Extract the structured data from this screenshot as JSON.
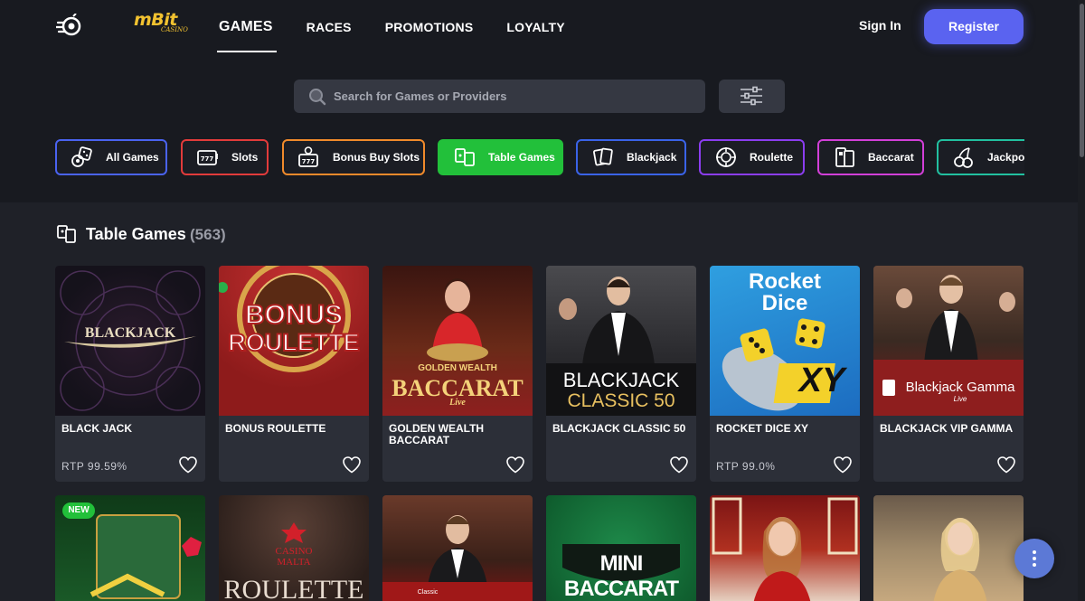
{
  "header": {
    "brand_main": "mBit",
    "brand_sub": "CASINO",
    "nav": [
      {
        "label": "GAMES",
        "active": true
      },
      {
        "label": "RACES",
        "active": false
      },
      {
        "label": "PROMOTIONS",
        "active": false
      },
      {
        "label": "LOYALTY",
        "active": false
      }
    ],
    "signin_label": "Sign In",
    "register_label": "Register"
  },
  "search": {
    "placeholder": "Search for Games or Providers",
    "icon": "search-icon",
    "filter_icon": "sliders-icon"
  },
  "categories": [
    {
      "label": "All Games",
      "icon": "dice-chips-icon",
      "color": "#4a63f0"
    },
    {
      "label": "Slots",
      "icon": "slot-777-icon",
      "color": "#e23b3b"
    },
    {
      "label": "Bonus Buy Slots",
      "icon": "bonus-slot-icon",
      "color": "#f08a2b"
    },
    {
      "label": "Table Games",
      "icon": "table-games-icon",
      "color": "#22c03a",
      "active": true
    },
    {
      "label": "Blackjack",
      "icon": "cards-icon",
      "color": "#3a63e8"
    },
    {
      "label": "Roulette",
      "icon": "roulette-icon",
      "color": "#8b3df0"
    },
    {
      "label": "Baccarat",
      "icon": "baccarat-icon",
      "color": "#d23fd8"
    },
    {
      "label": "Jackpot",
      "icon": "cherries-icon",
      "color": "#22c0a0"
    }
  ],
  "section": {
    "title": "Table Games",
    "count": "(563)"
  },
  "games": [
    {
      "name": "BLACK JACK",
      "rtp": "RTP 99.59%",
      "art_text": "BLACKJACK"
    },
    {
      "name": "BONUS ROULETTE",
      "rtp": "",
      "art_text_1": "BONUS",
      "art_text_2": "ROULETTE"
    },
    {
      "name": "GOLDEN WEALTH BACCARAT",
      "rtp": "",
      "art_text_1": "GOLDEN WEALTH",
      "art_text_2": "BACCARAT",
      "art_text_3": "Live"
    },
    {
      "name": "BLACKJACK CLASSIC 50",
      "rtp": "",
      "art_text_1": "BLACKJACK",
      "art_text_2": "CLASSIC 50"
    },
    {
      "name": "ROCKET DICE XY",
      "rtp": "RTP 99.0%",
      "art_text_1": "Rocket",
      "art_text_2": "Dice",
      "art_text_3": "XY"
    },
    {
      "name": "BLACKJACK VIP GAMMA",
      "rtp": "",
      "art_text_1": "Blackjack Gamma",
      "art_text_2": "Live"
    }
  ],
  "row2": [
    {
      "badge": "NEW"
    },
    {
      "art_text_1": "CASINO",
      "art_text_2": "MALTA",
      "art_text_3": "ROULETTE"
    },
    {
      "art_text_1": "Classic"
    },
    {
      "art_text_1": "MINI BACCARAT"
    },
    {},
    {}
  ],
  "colors": {
    "accent": "#5a63f0",
    "active_category": "#22c03a",
    "background": "#1f2128"
  }
}
